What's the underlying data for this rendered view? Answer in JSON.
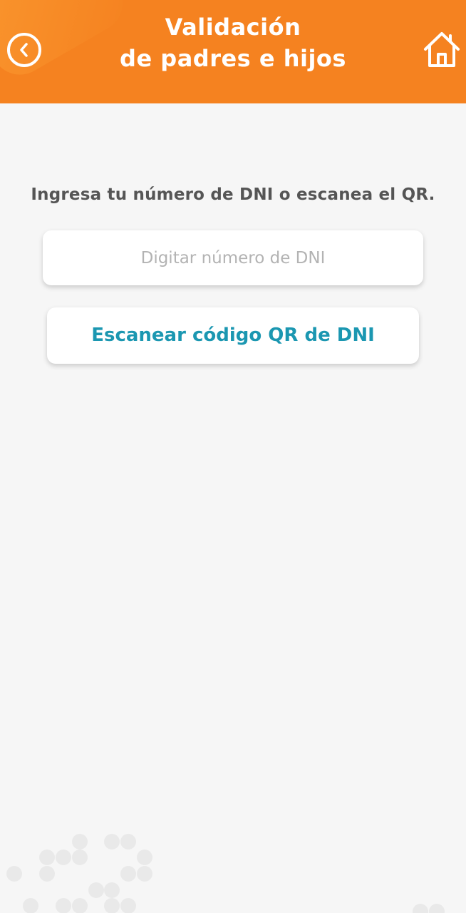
{
  "header": {
    "title_line1": "Validación",
    "title_line2": "de padres e hijos",
    "back_icon": "chevron-left-circle-icon",
    "home_icon": "home-icon",
    "background_color": "#f58220"
  },
  "main": {
    "prompt": "Ingresa tu número de DNI o escanea el QR.",
    "dni_input": {
      "placeholder": "Digitar número de DNI",
      "value": ""
    },
    "scan_button_label": "Escanear código QR de DNI",
    "accent_color": "#1b97b1"
  }
}
